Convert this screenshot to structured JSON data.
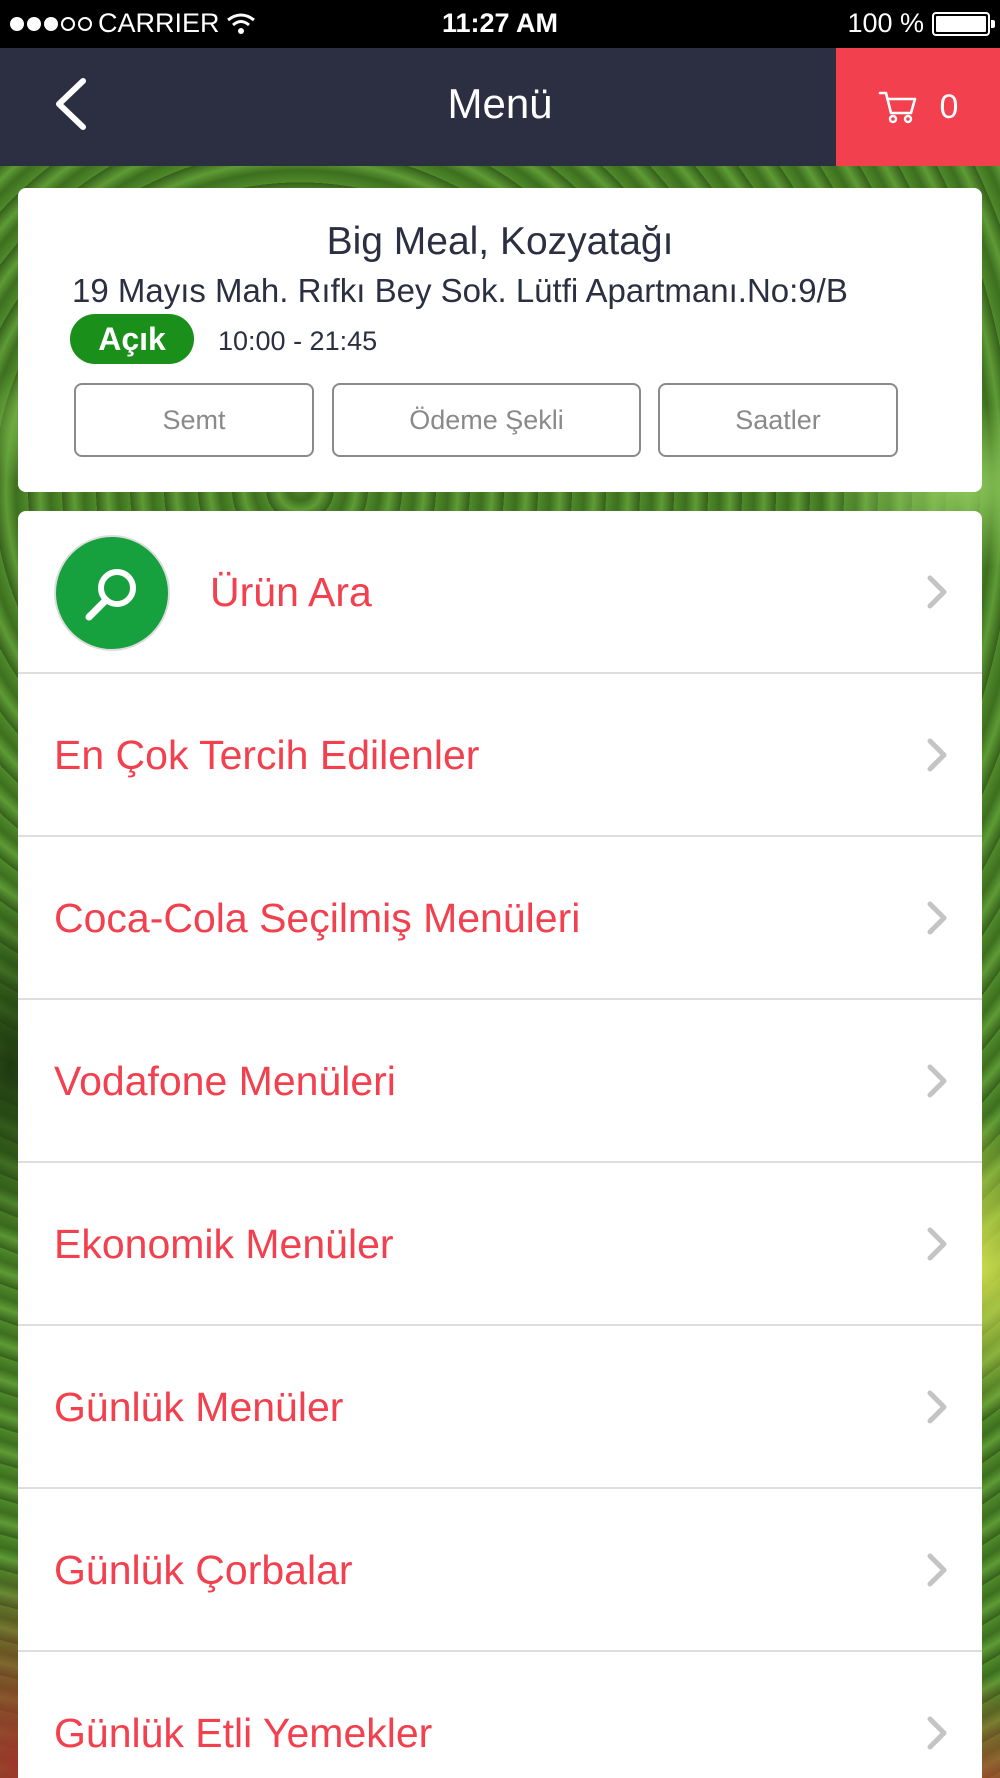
{
  "status_bar": {
    "carrier": "CARRIER",
    "time": "11:27 AM",
    "battery": "100 %"
  },
  "nav": {
    "title": "Menü",
    "cart_count": "0",
    "back_icon": "chevron-left-icon",
    "cart_icon": "cart-icon"
  },
  "restaurant": {
    "name": "Big Meal, Kozyatağı",
    "address": "19 Mayıs Mah. Rıfkı Bey Sok. Lütfi Apartmanı.No:9/B",
    "status": "Açık",
    "hours": "10:00 - 21:45",
    "buttons": [
      "Semt",
      "Ödeme Şekli",
      "Saatler"
    ]
  },
  "menu": {
    "items": [
      "Ürün Ara",
      "En Çok Tercih Edilenler",
      "Coca-Cola Seçilmiş Menüleri",
      "Vodafone Menüleri",
      "Ekonomik Menüler",
      "Günlük Menüler",
      "Günlük Çorbalar",
      "Günlük Etli Yemekler"
    ]
  },
  "colors": {
    "accent": "#f2404e",
    "nav_bg": "#2c2f42",
    "open_badge": "#1a8f1a",
    "search_icon_bg": "#16a03e"
  }
}
